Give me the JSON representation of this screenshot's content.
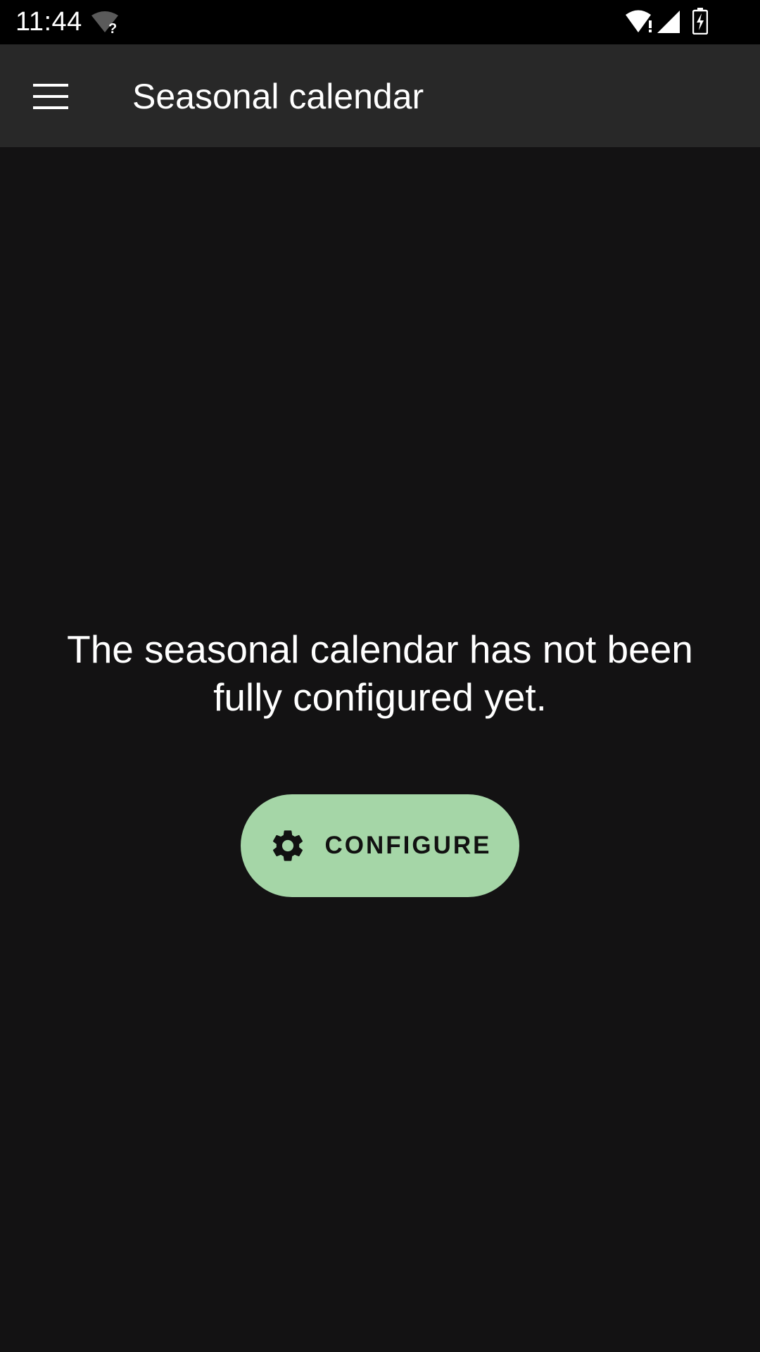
{
  "status_bar": {
    "time": "11:44",
    "icons": [
      "wifi-question-icon",
      "wifi-alert-icon",
      "cell-signal-icon",
      "battery-charging-icon"
    ]
  },
  "app_bar": {
    "title": "Seasonal calendar",
    "menu_icon": "hamburger-menu-icon"
  },
  "main": {
    "message": "The seasonal calendar has not been fully configured yet.",
    "configure_button": {
      "label": "CONFIGURE",
      "icon": "gear-icon"
    }
  },
  "colors": {
    "background": "#131213",
    "app_bar": "#282828",
    "status_bar": "#000000",
    "button": "#a5d6a7",
    "button_text": "#111111"
  }
}
